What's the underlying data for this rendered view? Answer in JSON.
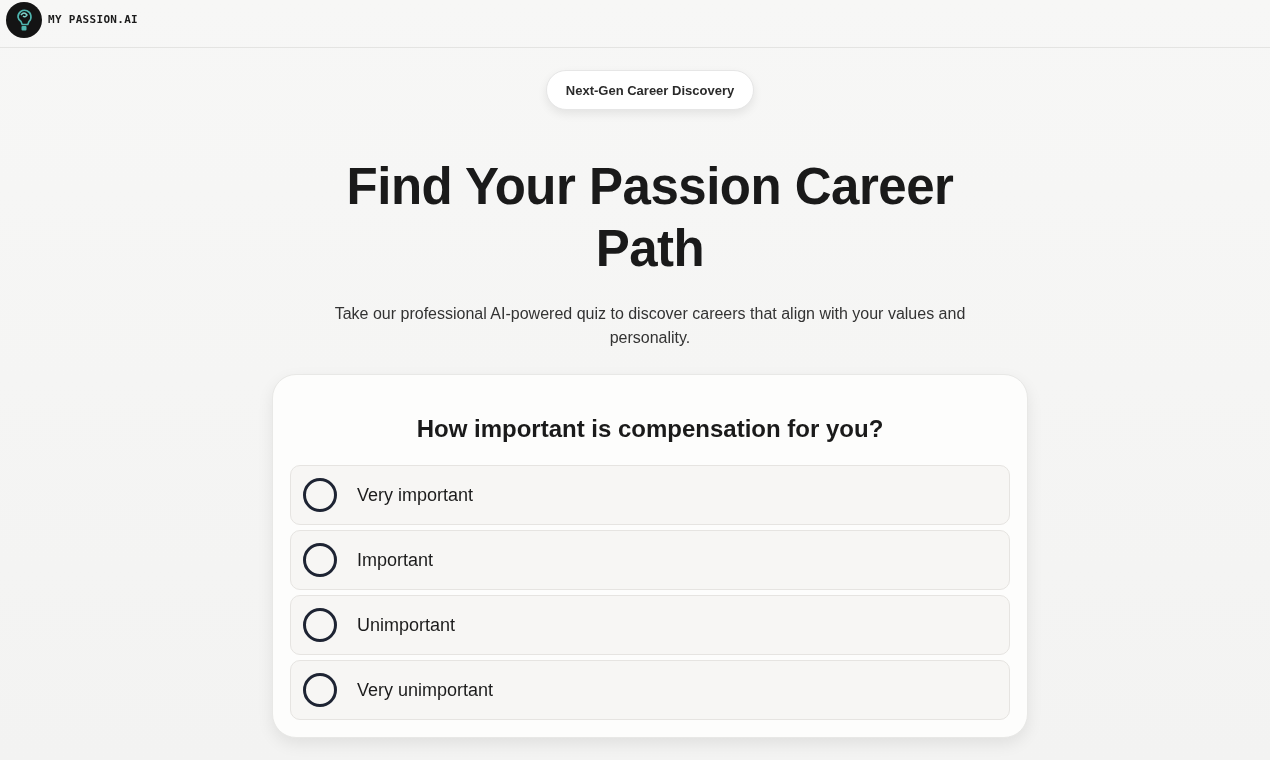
{
  "header": {
    "brand": "MY PASSION.AI"
  },
  "hero": {
    "badge": "Next-Gen Career Discovery",
    "title": "Find Your Passion Career Path",
    "subtitle": "Take our professional AI-powered quiz to discover careers that align with your values and personality."
  },
  "quiz": {
    "question": "How important is compensation for you?",
    "options": [
      {
        "label": "Very important",
        "selected": false
      },
      {
        "label": "Important",
        "selected": false
      },
      {
        "label": "Unimportant",
        "selected": false
      },
      {
        "label": "Very unimportant",
        "selected": false
      }
    ]
  }
}
